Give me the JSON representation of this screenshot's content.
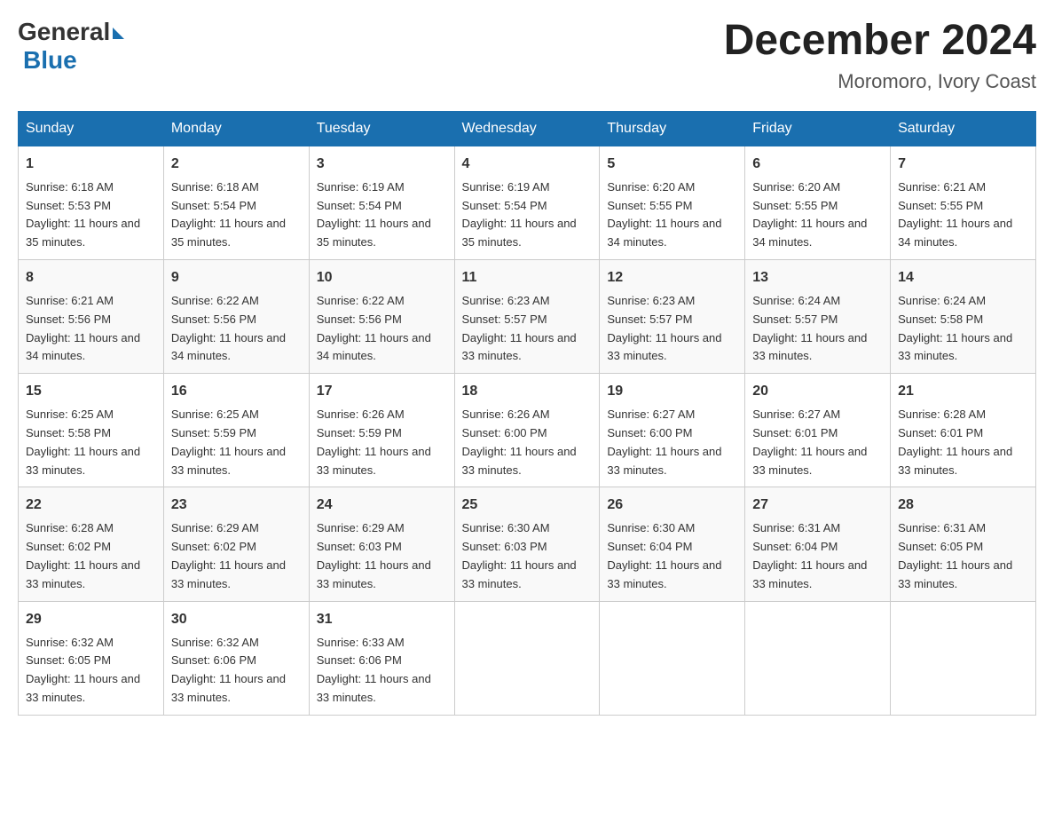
{
  "header": {
    "logo_general": "General",
    "logo_blue": "Blue",
    "title": "December 2024",
    "location": "Moromoro, Ivory Coast"
  },
  "weekdays": [
    "Sunday",
    "Monday",
    "Tuesday",
    "Wednesday",
    "Thursday",
    "Friday",
    "Saturday"
  ],
  "weeks": [
    [
      {
        "day": "1",
        "sunrise": "6:18 AM",
        "sunset": "5:53 PM",
        "daylight": "11 hours and 35 minutes."
      },
      {
        "day": "2",
        "sunrise": "6:18 AM",
        "sunset": "5:54 PM",
        "daylight": "11 hours and 35 minutes."
      },
      {
        "day": "3",
        "sunrise": "6:19 AM",
        "sunset": "5:54 PM",
        "daylight": "11 hours and 35 minutes."
      },
      {
        "day": "4",
        "sunrise": "6:19 AM",
        "sunset": "5:54 PM",
        "daylight": "11 hours and 35 minutes."
      },
      {
        "day": "5",
        "sunrise": "6:20 AM",
        "sunset": "5:55 PM",
        "daylight": "11 hours and 34 minutes."
      },
      {
        "day": "6",
        "sunrise": "6:20 AM",
        "sunset": "5:55 PM",
        "daylight": "11 hours and 34 minutes."
      },
      {
        "day": "7",
        "sunrise": "6:21 AM",
        "sunset": "5:55 PM",
        "daylight": "11 hours and 34 minutes."
      }
    ],
    [
      {
        "day": "8",
        "sunrise": "6:21 AM",
        "sunset": "5:56 PM",
        "daylight": "11 hours and 34 minutes."
      },
      {
        "day": "9",
        "sunrise": "6:22 AM",
        "sunset": "5:56 PM",
        "daylight": "11 hours and 34 minutes."
      },
      {
        "day": "10",
        "sunrise": "6:22 AM",
        "sunset": "5:56 PM",
        "daylight": "11 hours and 34 minutes."
      },
      {
        "day": "11",
        "sunrise": "6:23 AM",
        "sunset": "5:57 PM",
        "daylight": "11 hours and 33 minutes."
      },
      {
        "day": "12",
        "sunrise": "6:23 AM",
        "sunset": "5:57 PM",
        "daylight": "11 hours and 33 minutes."
      },
      {
        "day": "13",
        "sunrise": "6:24 AM",
        "sunset": "5:57 PM",
        "daylight": "11 hours and 33 minutes."
      },
      {
        "day": "14",
        "sunrise": "6:24 AM",
        "sunset": "5:58 PM",
        "daylight": "11 hours and 33 minutes."
      }
    ],
    [
      {
        "day": "15",
        "sunrise": "6:25 AM",
        "sunset": "5:58 PM",
        "daylight": "11 hours and 33 minutes."
      },
      {
        "day": "16",
        "sunrise": "6:25 AM",
        "sunset": "5:59 PM",
        "daylight": "11 hours and 33 minutes."
      },
      {
        "day": "17",
        "sunrise": "6:26 AM",
        "sunset": "5:59 PM",
        "daylight": "11 hours and 33 minutes."
      },
      {
        "day": "18",
        "sunrise": "6:26 AM",
        "sunset": "6:00 PM",
        "daylight": "11 hours and 33 minutes."
      },
      {
        "day": "19",
        "sunrise": "6:27 AM",
        "sunset": "6:00 PM",
        "daylight": "11 hours and 33 minutes."
      },
      {
        "day": "20",
        "sunrise": "6:27 AM",
        "sunset": "6:01 PM",
        "daylight": "11 hours and 33 minutes."
      },
      {
        "day": "21",
        "sunrise": "6:28 AM",
        "sunset": "6:01 PM",
        "daylight": "11 hours and 33 minutes."
      }
    ],
    [
      {
        "day": "22",
        "sunrise": "6:28 AM",
        "sunset": "6:02 PM",
        "daylight": "11 hours and 33 minutes."
      },
      {
        "day": "23",
        "sunrise": "6:29 AM",
        "sunset": "6:02 PM",
        "daylight": "11 hours and 33 minutes."
      },
      {
        "day": "24",
        "sunrise": "6:29 AM",
        "sunset": "6:03 PM",
        "daylight": "11 hours and 33 minutes."
      },
      {
        "day": "25",
        "sunrise": "6:30 AM",
        "sunset": "6:03 PM",
        "daylight": "11 hours and 33 minutes."
      },
      {
        "day": "26",
        "sunrise": "6:30 AM",
        "sunset": "6:04 PM",
        "daylight": "11 hours and 33 minutes."
      },
      {
        "day": "27",
        "sunrise": "6:31 AM",
        "sunset": "6:04 PM",
        "daylight": "11 hours and 33 minutes."
      },
      {
        "day": "28",
        "sunrise": "6:31 AM",
        "sunset": "6:05 PM",
        "daylight": "11 hours and 33 minutes."
      }
    ],
    [
      {
        "day": "29",
        "sunrise": "6:32 AM",
        "sunset": "6:05 PM",
        "daylight": "11 hours and 33 minutes."
      },
      {
        "day": "30",
        "sunrise": "6:32 AM",
        "sunset": "6:06 PM",
        "daylight": "11 hours and 33 minutes."
      },
      {
        "day": "31",
        "sunrise": "6:33 AM",
        "sunset": "6:06 PM",
        "daylight": "11 hours and 33 minutes."
      },
      null,
      null,
      null,
      null
    ]
  ],
  "labels": {
    "sunrise_prefix": "Sunrise: ",
    "sunset_prefix": "Sunset: ",
    "daylight_prefix": "Daylight: "
  }
}
